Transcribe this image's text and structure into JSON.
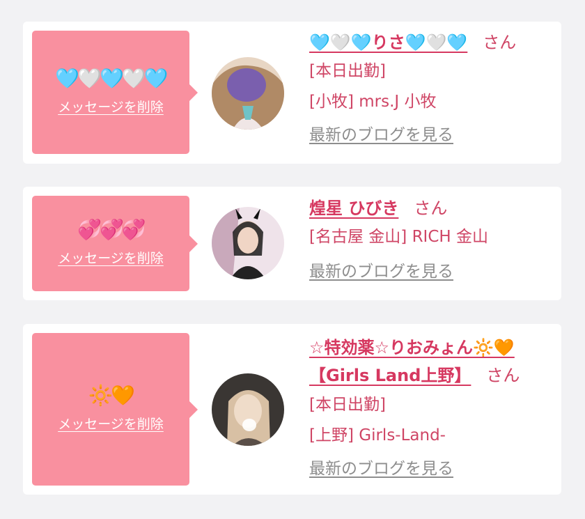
{
  "cards": [
    {
      "bubble_emoji": "🩵🤍🩵🤍🩵",
      "delete_label": "メッセージを削除",
      "name": "🩵🤍🩵りさ🩵🤍🩵",
      "san": "さん",
      "meta": [
        "[本日出勤]",
        "[小牧] mrs.J 小牧"
      ],
      "blog_link": "最新のブログを見る",
      "avatar_palette": [
        "#f0e0d0",
        "#8a6a9a",
        "#c8a27c",
        "#5e4a3a"
      ]
    },
    {
      "bubble_emoji": "💞💞💞",
      "delete_label": "メッセージを削除",
      "name": "煌星 ひびき",
      "san": "さん",
      "meta": [
        "[名古屋 金山] RICH 金山"
      ],
      "blog_link": "最新のブログを見る",
      "avatar_palette": [
        "#f3e9ee",
        "#1d1d1d",
        "#e8cbbd",
        "#c7a6b5"
      ]
    },
    {
      "bubble_emoji": "🔆🧡",
      "delete_label": "メッセージを削除",
      "name": "☆特効薬☆りおみょん🔆🧡【Girls Land上野】",
      "san": "さん",
      "meta": [
        "[本日出勤]",
        "[上野] Girls-Land-"
      ],
      "blog_link": "最新のブログを見る",
      "avatar_palette": [
        "#3b3835",
        "#d9c2a6",
        "#f2e1c8",
        "#7c6c5c"
      ]
    }
  ]
}
